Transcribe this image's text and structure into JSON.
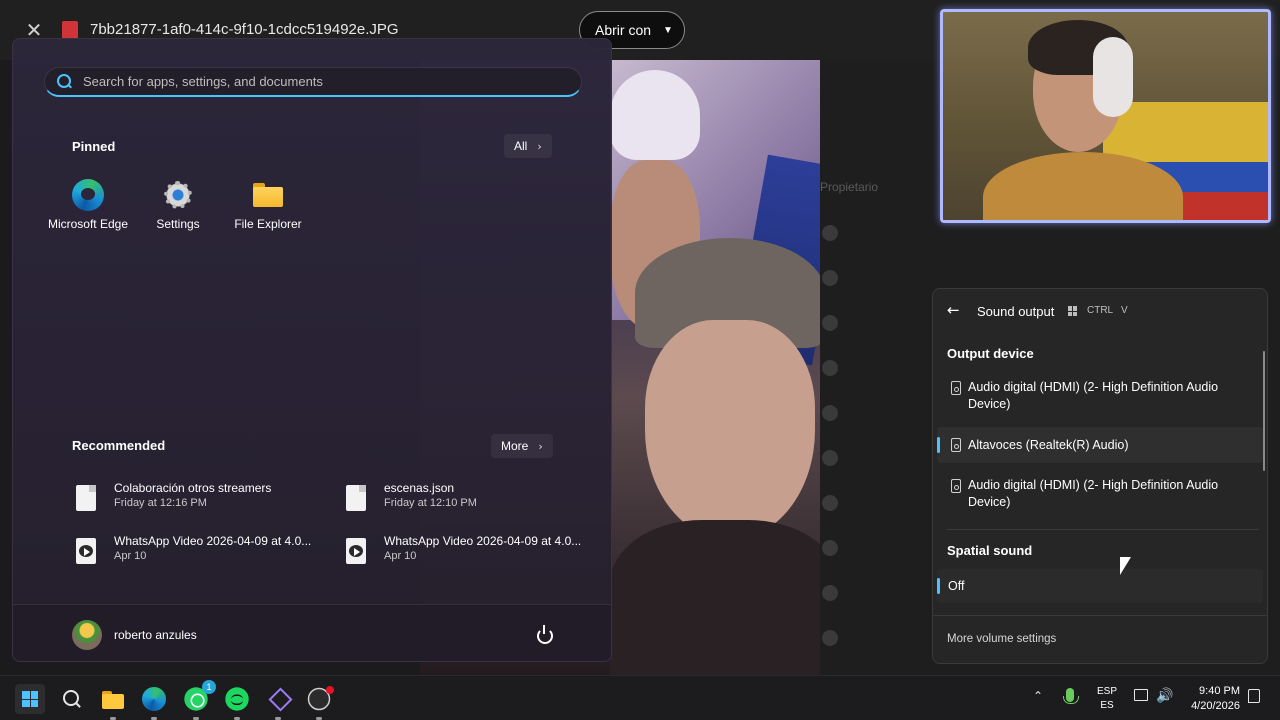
{
  "viewer": {
    "filename": "7bb21877-1af0-414c-9f10-1cdcc519492e.JPG",
    "open_with": "Abrir con",
    "list_header": "Propietario"
  },
  "start_menu": {
    "search_placeholder": "Search for apps, settings, and documents",
    "pinned_title": "Pinned",
    "all_button": "All",
    "pinned_apps": [
      {
        "label": "Microsoft Edge",
        "icon": "edge-icon"
      },
      {
        "label": "Settings",
        "icon": "gear-icon"
      },
      {
        "label": "File Explorer",
        "icon": "folder-icon"
      }
    ],
    "recommended_title": "Recommended",
    "more_button": "More",
    "recommended": [
      {
        "name": "Colaboración otros streamers",
        "date": "Friday at 12:16 PM",
        "icon": "document-icon"
      },
      {
        "name": "escenas.json",
        "date": "Friday at 12:10 PM",
        "icon": "document-icon"
      },
      {
        "name": "WhatsApp Video 2026-04-09 at 4.0...",
        "date": "Apr 10",
        "icon": "video-file-icon"
      },
      {
        "name": "WhatsApp Video 2026-04-09 at 4.0...",
        "date": "Apr 10",
        "icon": "video-file-icon"
      }
    ],
    "user_name": "roberto anzules"
  },
  "sound_panel": {
    "title": "Sound output",
    "shortcut_key1": "CTRL",
    "shortcut_key2": "V",
    "output_device_label": "Output device",
    "devices": [
      {
        "label": "Audio digital (HDMI) (2- High Definition Audio Device)",
        "selected": false
      },
      {
        "label": "Altavoces (Realtek(R) Audio)",
        "selected": true
      },
      {
        "label": "Audio digital (HDMI) (2- High Definition Audio Device)",
        "selected": false
      }
    ],
    "spatial_sound_label": "Spatial sound",
    "spatial_value": "Off",
    "more_volume": "More volume settings",
    "accent_color": "#4cc2ff"
  },
  "taskbar": {
    "whatsapp_badge": "1",
    "lang_line1": "ESP",
    "lang_line2": "ES",
    "time": "9:40 PM",
    "date": "4/20/2026"
  }
}
